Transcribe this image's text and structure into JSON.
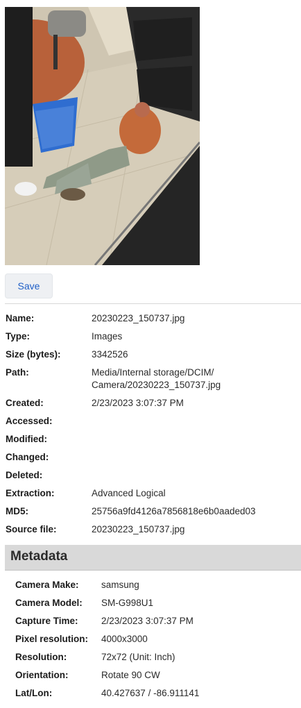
{
  "image": {
    "icon": "photo-thumbnail"
  },
  "toolbar": {
    "save_label": "Save"
  },
  "properties": [
    {
      "label": "Name:",
      "value": "20230223_150737.jpg"
    },
    {
      "label": "Type:",
      "value": "Images"
    },
    {
      "label": "Size (bytes):",
      "value": "3342526"
    },
    {
      "label": "Path:",
      "value": "Media/Internal storage/DCIM/\nCamera/20230223_150737.jpg"
    },
    {
      "label": "Created:",
      "value": "2/23/2023 3:07:37 PM"
    },
    {
      "label": "Accessed:",
      "value": ""
    },
    {
      "label": "Modified:",
      "value": ""
    },
    {
      "label": "Changed:",
      "value": ""
    },
    {
      "label": "Deleted:",
      "value": ""
    },
    {
      "label": "Extraction:",
      "value": "Advanced Logical"
    },
    {
      "label": "MD5:",
      "value": "25756a9fd4126a7856818e6b0aaded03"
    },
    {
      "label": "Source file:",
      "value": "20230223_150737.jpg"
    }
  ],
  "metadata": {
    "title": "Metadata",
    "rows": [
      {
        "label": "Camera Make:",
        "value": "samsung"
      },
      {
        "label": "Camera Model:",
        "value": "SM-G998U1"
      },
      {
        "label": "Capture Time:",
        "value": "2/23/2023 3:07:37 PM"
      },
      {
        "label": "Pixel resolution:",
        "value": "4000x3000"
      },
      {
        "label": "Resolution:",
        "value": "72x72 (Unit: Inch)"
      },
      {
        "label": "Orientation:",
        "value": "Rotate 90 CW"
      },
      {
        "label": "Lat/Lon:",
        "value": "40.427637 / -86.911141"
      }
    ]
  }
}
